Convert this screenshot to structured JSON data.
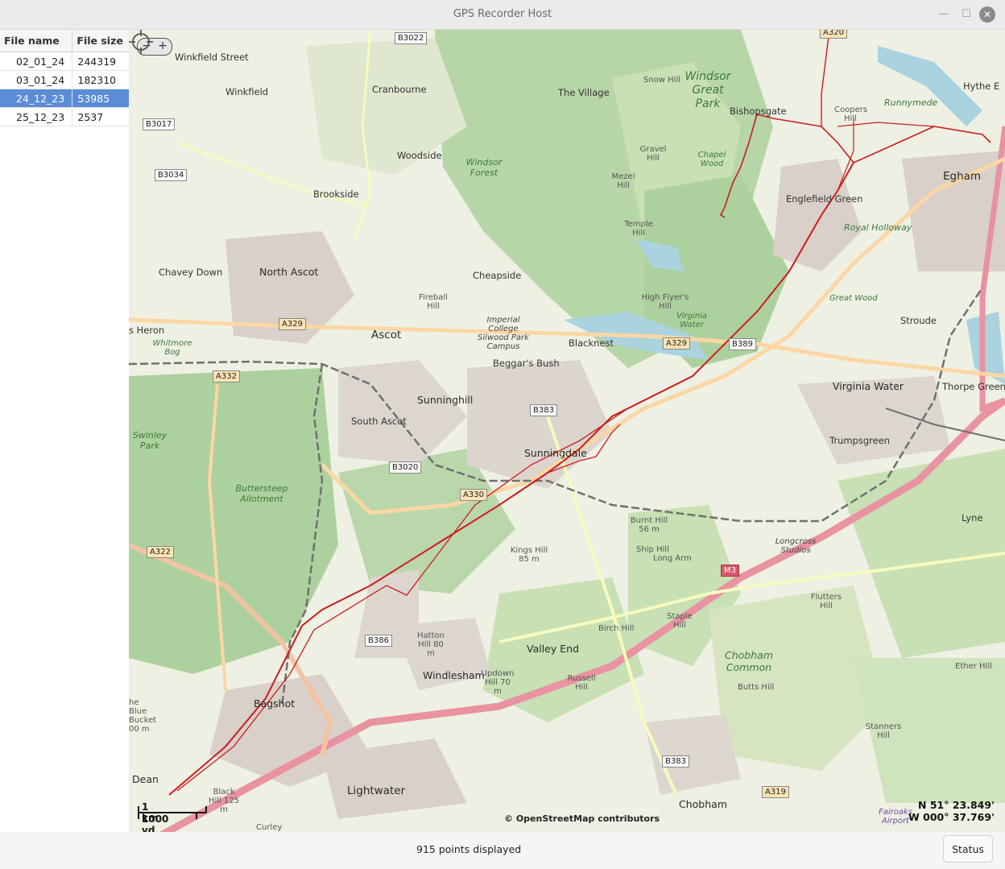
{
  "window": {
    "title": "GPS Recorder Host"
  },
  "file_table": {
    "headers": {
      "name": "File name",
      "size": "File size"
    },
    "rows": [
      {
        "name": "02_01_24",
        "size": "244319"
      },
      {
        "name": "03_01_24",
        "size": "182310"
      },
      {
        "name": "24_12_23",
        "size": "53985",
        "selected": true
      },
      {
        "name": "25_12_23",
        "size": "2537"
      }
    ]
  },
  "map": {
    "zoom": {
      "minus": "−",
      "plus": "+"
    },
    "scale": {
      "km": "1 km",
      "yd": "1000 yd"
    },
    "attribution": "© OpenStreetMap contributors",
    "coords": {
      "lat": "N 51° 23.849'",
      "lon": "W 000° 37.769'"
    },
    "labels": {
      "winkfield_street": "Winkfield Street",
      "winkfield": "Winkfield",
      "cranbourne": "Cranbourne",
      "the_village": "The Village",
      "snow_hill": "Snow Hill",
      "windsor_great_park": "Windsor Great Park",
      "bishopsgate": "Bishopsgate",
      "hythe": "Hythe E",
      "coopers_hill": "Coopers Hill",
      "runnymede": "Runnymede",
      "egham": "Egham",
      "englefield_green": "Englefield Green",
      "royal_holloway": "Royal Holloway",
      "woodside": "Woodside",
      "windsor_forest": "Windsor Forest",
      "gravel_hill": "Gravel Hill",
      "chapel_wood": "Chapel Wood",
      "mezel_hill": "Mezel Hill",
      "temple_hill": "Temple Hill",
      "brookside": "Brookside",
      "chavey_down": "Chavey Down",
      "north_ascot": "North Ascot",
      "cheapside": "Cheapside",
      "fireball_hill": "Fireball Hill",
      "high_flyers_hill": "High Flyer's Hill",
      "virginia_water_lake": "Virginia Water",
      "great_wood": "Great Wood",
      "stroude": "Stroude",
      "heron": "s Heron",
      "whitmore_bog": "Whitmore Bog",
      "ascot": "Ascot",
      "imperial_college": "Imperial College Silwood Park Campus",
      "blacknest": "Blacknest",
      "beggars_bush": "Beggar's Bush",
      "virginia_water": "Virginia Water",
      "thorpe_green": "Thorpe Green",
      "sunninghill": "Sunninghill",
      "south_ascot": "South Ascot",
      "swinley_park": "Swinley Park",
      "sunningdale": "Sunningdale",
      "trumpsgreen": "Trumpsgreen",
      "buttersteep": "Buttersteep Allotment",
      "burnt_hill": "Burnt Hill 56 m",
      "ship_hill": "Ship Hill",
      "long_arm": "Long Arm",
      "kings_hill": "Kings Hill 85 m",
      "lyne": "Lyne",
      "longcross_studios": "Longcross Studios",
      "flutters_hill": "Flutters Hill",
      "staple_hill": "Staple Hill",
      "birch_hill": "Birch Hill",
      "hatton_hill": "Hatton Hill 80 m",
      "valley_end": "Valley End",
      "windlesham": "Windlesham",
      "updown_hill": "Updown Hill 70 m",
      "russell_hill": "Russell Hill",
      "chobham_common": "Chobham Common",
      "butts_hill": "Butts Hill",
      "ether_hill": "Ether Hill",
      "bagshot": "Bagshot",
      "blue_bucket": "he Blue Bucket 00 m",
      "stanners_hill": "Stanners Hill",
      "dean": "Dean",
      "lightwater": "Lightwater",
      "black_hill": "Black Hill 125 m",
      "chobham": "Chobham",
      "fairoaks": "Fairoaks Airport",
      "curley": "Curley"
    },
    "shields": {
      "b3022": "B3022",
      "b3017": "B3017",
      "b3034": "B3034",
      "a329_w": "A329",
      "a329_e": "A329",
      "b389": "B389",
      "a332": "A332",
      "b383_n": "B383",
      "b3020": "B3020",
      "a330": "A330",
      "a322": "A322",
      "m3": "M3",
      "b386": "B386",
      "b383_s": "B383",
      "a319": "A319",
      "a320": "A320"
    }
  },
  "status": {
    "points_text": "915 points displayed",
    "button": "Status"
  }
}
